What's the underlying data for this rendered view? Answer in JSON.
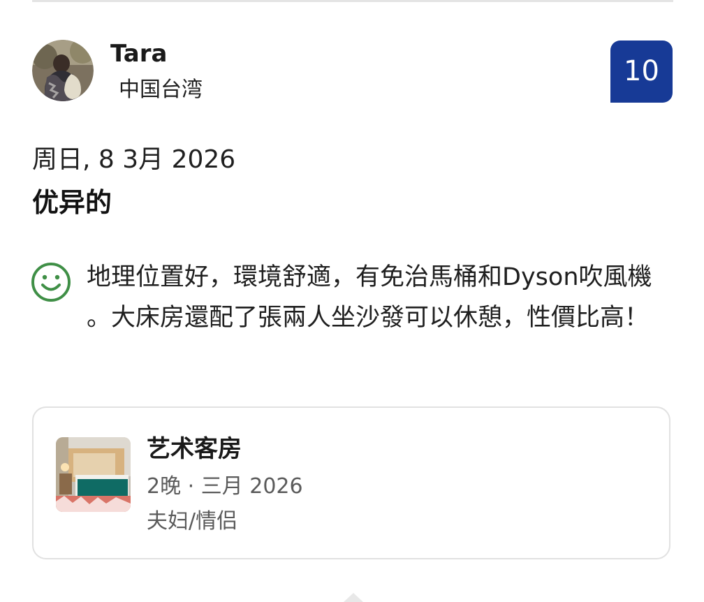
{
  "reviewer": {
    "name": "Tara",
    "country": "中国台湾",
    "avatar_icon": "reviewer-avatar-photo"
  },
  "score": {
    "value": "10",
    "color": "#173a96"
  },
  "review": {
    "date": "周日, 8 3月 2026",
    "title": "优异的",
    "positive_icon": "smile-icon",
    "positive_icon_color": "#3f8f46",
    "text": "地理位置好，環境舒適，有免治馬桶和Dyson吹風機 。大床房還配了張兩人坐沙發可以休憩，性價比高！"
  },
  "room": {
    "name": "艺术客房",
    "stay": "2晚 · 三月 2026",
    "traveler_type": "夫妇/情侣",
    "thumbnail_icon": "room-photo"
  }
}
